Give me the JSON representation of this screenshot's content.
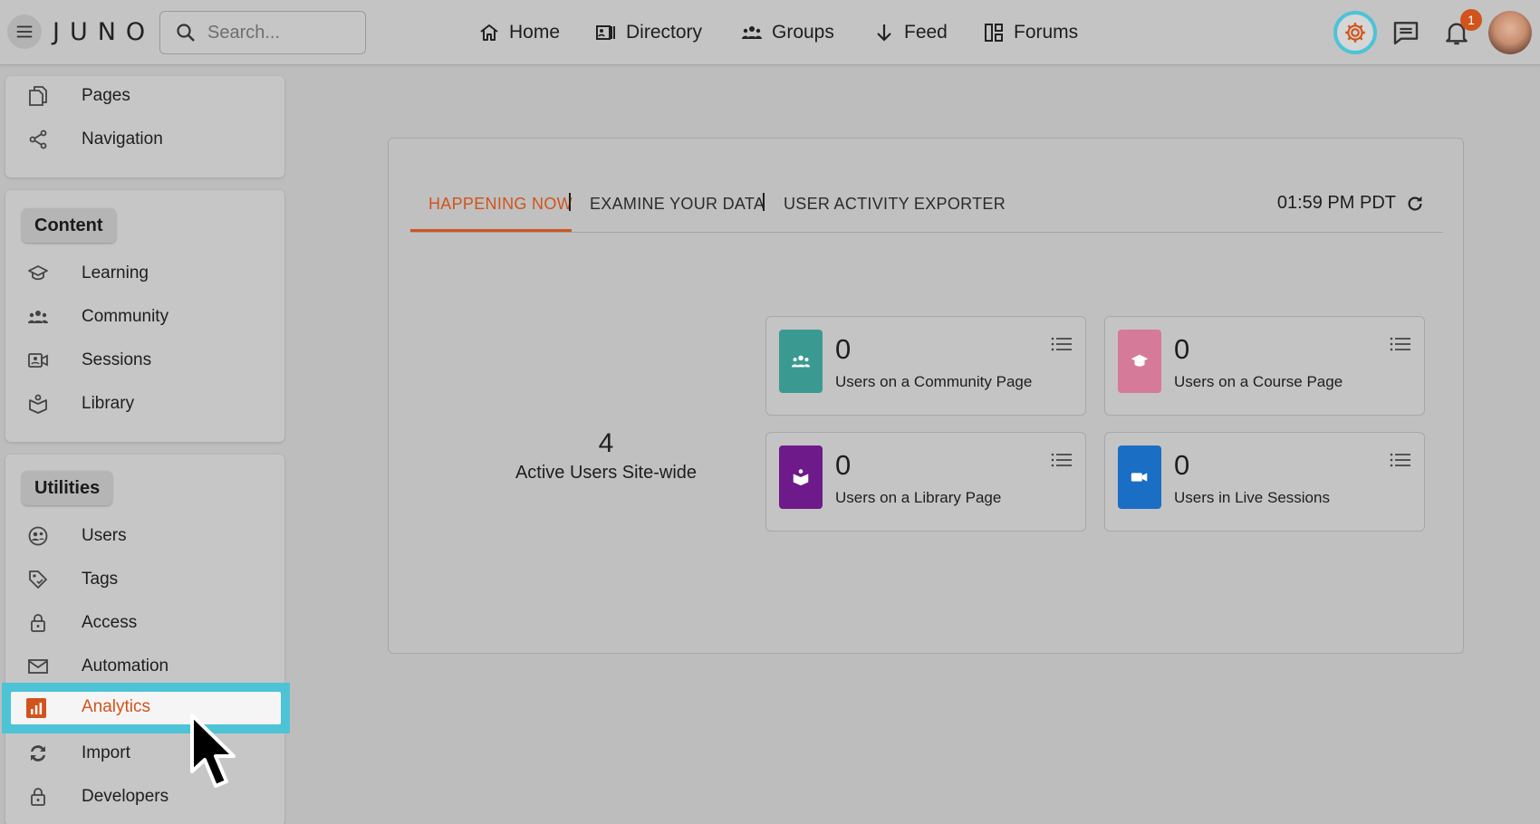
{
  "app": {
    "logo": "JUNO"
  },
  "search": {
    "placeholder": "Search..."
  },
  "nav": [
    {
      "label": "Home",
      "icon": "home-icon"
    },
    {
      "label": "Directory",
      "icon": "directory-icon"
    },
    {
      "label": "Groups",
      "icon": "groups-icon"
    },
    {
      "label": "Feed",
      "icon": "arrow-down-icon"
    },
    {
      "label": "Forums",
      "icon": "forums-icon"
    }
  ],
  "header": {
    "notification_count": "1"
  },
  "sidebar": {
    "top_items": [
      {
        "label": "Pages",
        "icon": "pages-icon"
      },
      {
        "label": "Navigation",
        "icon": "share-icon"
      }
    ],
    "content": {
      "title": "Content",
      "items": [
        {
          "label": "Learning",
          "icon": "graduation-cap-icon"
        },
        {
          "label": "Community",
          "icon": "people-icon"
        },
        {
          "label": "Sessions",
          "icon": "video-icon"
        },
        {
          "label": "Library",
          "icon": "book-icon"
        }
      ]
    },
    "utilities": {
      "title": "Utilities",
      "items": [
        {
          "label": "Users",
          "icon": "users-circle-icon"
        },
        {
          "label": "Tags",
          "icon": "tag-icon"
        },
        {
          "label": "Access",
          "icon": "lock-icon"
        },
        {
          "label": "Automation",
          "icon": "mail-icon"
        },
        {
          "label": "Analytics",
          "icon": "analytics-icon",
          "selected": true
        },
        {
          "label": "Import",
          "icon": "sync-icon"
        },
        {
          "label": "Developers",
          "icon": "lock-icon"
        }
      ]
    }
  },
  "tabs": [
    {
      "label": "HAPPENING NOW",
      "active": true
    },
    {
      "label": "EXAMINE YOUR DATA"
    },
    {
      "label": "USER ACTIVITY EXPORTER"
    }
  ],
  "time": "01:59 PM PDT",
  "active_users": {
    "count": "4",
    "label": "Active Users Site-wide"
  },
  "stats": [
    {
      "value": "0",
      "label": "Users on a Community Page",
      "color": "#3a9a92",
      "icon": "people-icon"
    },
    {
      "value": "0",
      "label": "Users on a Course Page",
      "color": "#d67a9a",
      "icon": "graduation-cap-icon"
    },
    {
      "value": "0",
      "label": "Users on a Library Page",
      "color": "#6e1a8a",
      "icon": "book-icon"
    },
    {
      "value": "0",
      "label": "Users in Live Sessions",
      "color": "#1a6ec4",
      "icon": "video-icon"
    }
  ],
  "colors": {
    "accent": "#d0541c",
    "highlight": "#4dc3d6"
  }
}
